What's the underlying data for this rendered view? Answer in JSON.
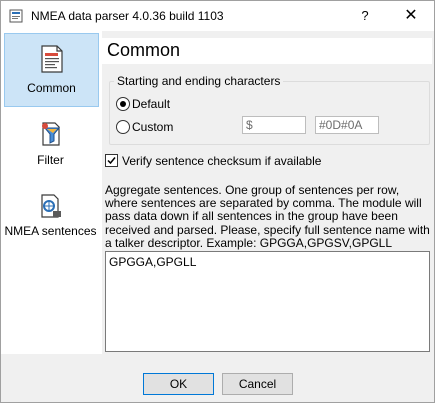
{
  "window": {
    "title": "NMEA data parser 4.0.36 build 1103",
    "help_glyph": "?",
    "close_glyph": "✕"
  },
  "sidebar": {
    "items": [
      {
        "label": "Common",
        "icon": "document-icon",
        "selected": true
      },
      {
        "label": "Filter",
        "icon": "filter-icon",
        "selected": false
      },
      {
        "label": "NMEA sentences",
        "icon": "sentences-icon",
        "selected": false
      }
    ]
  },
  "page": {
    "title": "Common",
    "group": {
      "legend": "Starting and ending characters",
      "default_label": "Default",
      "custom_label": "Custom",
      "selected": "Default",
      "start_value": "$",
      "end_value": "#0D#0A"
    },
    "checksum": {
      "label": "Verify sentence checksum if available",
      "checked": true
    },
    "description": "Aggregate sentences. One group of sentences per row, where sentences are separated by comma. The module will pass data down if all sentences in the group have been received and parsed. Please, specify full sentence name with a talker descriptor. Example: GPGGA,GPGSV,GPGLL",
    "memo_text": "GPGGA,GPGLL"
  },
  "buttons": {
    "ok_label": "OK",
    "cancel_label": "Cancel"
  },
  "colors": {
    "selection_bg": "#cce4f7",
    "selection_border": "#99c9ef",
    "default_button_border": "#0078d7"
  }
}
